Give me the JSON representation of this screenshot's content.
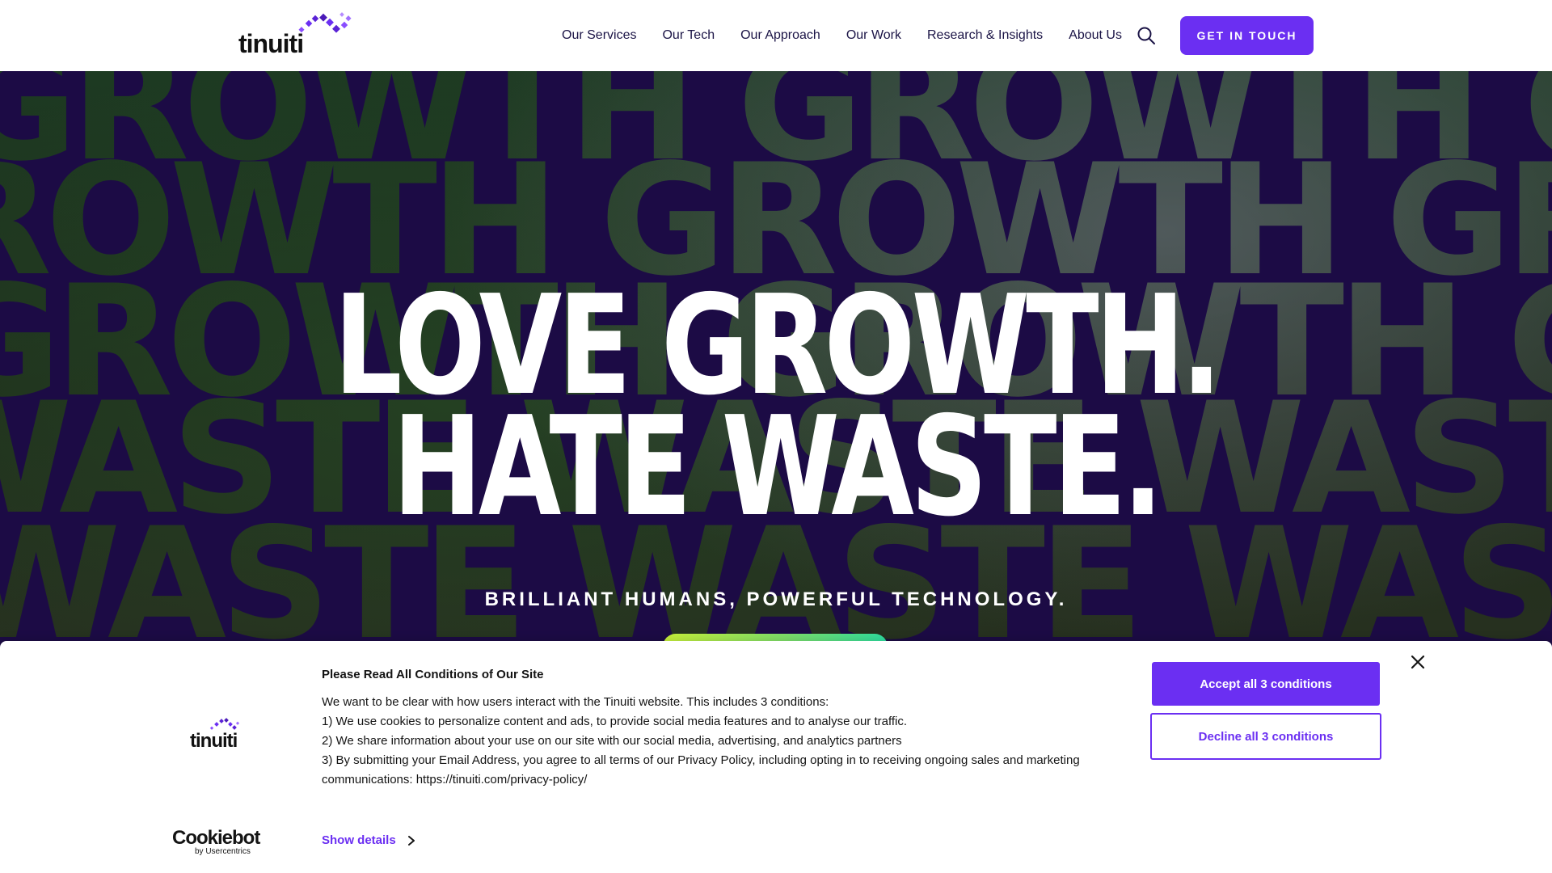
{
  "header": {
    "logo_text": "tinuiti",
    "nav": [
      "Our Services",
      "Our Tech",
      "Our Approach",
      "Our Work",
      "Research & Insights",
      "About Us"
    ],
    "cta_label": "GET IN TOUCH"
  },
  "hero": {
    "background_words": [
      "GROWTH GROWTH GROWTH GROWTH",
      "GROWTH GROWTH GROWTH GROWTH",
      "GROWTH GROWTH GROWTH GROWTH",
      "WASTE WASTE WASTE WASTE WASTE",
      "WASTE WASTE WASTE WASTE WASTE"
    ],
    "headline_line1": "LOVE GROWTH.",
    "headline_line2": "HATE WASTE.",
    "tagline": "BRILLIANT HUMANS, POWERFUL TECHNOLOGY."
  },
  "cookie": {
    "logo_text": "tinuiti",
    "title": "Please Read All Conditions of Our Site",
    "body": [
      "We want to be clear with how users interact with the Tinuiti website. This includes 3 conditions:",
      "1) We use cookies to personalize content and ads, to provide social media features and to analyse our traffic.",
      "2) We share information about your use on our site with our social media, advertising, and analytics partners",
      "3) By submitting your Email Address, you agree to all terms of our Privacy Policy, including opting in to receiving ongoing sales and marketing communications: https://tinuiti.com/privacy-policy/"
    ],
    "accept_label": "Accept all 3 conditions",
    "decline_label": "Decline all 3 conditions",
    "show_details_label": "Show details",
    "cookiebot_name": "Cookiebot",
    "cookiebot_sub": "by Usercentrics"
  },
  "colors": {
    "accent": "#6b2ff2",
    "hero_overlay": "#1c0b45",
    "nav_text": "#1b1446"
  }
}
